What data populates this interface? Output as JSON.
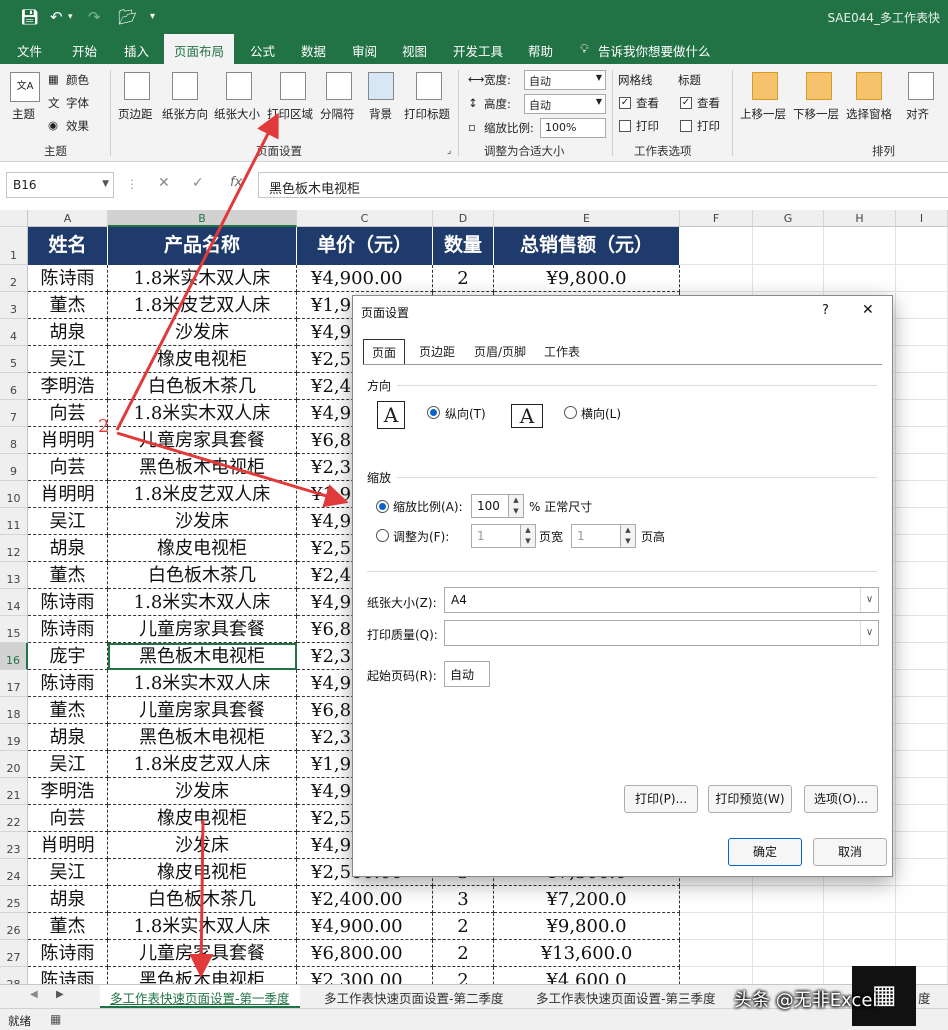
{
  "title_bar": {
    "doc_title": "SAE044_多工作表快"
  },
  "menu": {
    "tabs": [
      "文件",
      "开始",
      "插入",
      "页面布局",
      "公式",
      "数据",
      "审阅",
      "视图",
      "开发工具",
      "帮助"
    ],
    "tell_me": "告诉我你想要做什么"
  },
  "ribbon": {
    "theme": {
      "theme": "主题",
      "colors": "颜色",
      "fonts": "字体",
      "effects": "效果",
      "group": "主题"
    },
    "page_setup": {
      "margins": "页边距",
      "orientation": "纸张方向",
      "size": "纸张大小",
      "print_area": "打印区域",
      "breaks": "分隔符",
      "background": "背景",
      "print_titles": "打印标题",
      "group": "页面设置"
    },
    "scale": {
      "width_label": "宽度:",
      "width_value": "自动",
      "height_label": "高度:",
      "height_value": "自动",
      "scale_label": "缩放比例:",
      "scale_value": "100%",
      "group": "调整为合适大小"
    },
    "sheet_options": {
      "gridlines": "网格线",
      "headings": "标题",
      "view": "查看",
      "print": "打印",
      "group": "工作表选项"
    },
    "arrange": {
      "forward": "上移一层",
      "backward": "下移一层",
      "selection_pane": "选择窗格",
      "align": "对齐",
      "group": "排列"
    }
  },
  "formula_bar": {
    "name_box": "B16",
    "fx": "fx",
    "content": "黑色板木电视柜"
  },
  "columns": [
    "A",
    "B",
    "C",
    "D",
    "E",
    "F",
    "G",
    "H",
    "I"
  ],
  "table": {
    "headers": [
      "姓名",
      "产品名称",
      "单价（元）",
      "数量",
      "总销售额（元）"
    ],
    "rows": [
      [
        "陈诗雨",
        "1.8米实木双人床",
        "¥4,900.00",
        "2",
        "¥9,800.0"
      ],
      [
        "董杰",
        "1.8米皮艺双人床",
        "¥1,9",
        "",
        ""
      ],
      [
        "胡泉",
        "沙发床",
        "¥4,9",
        "",
        ""
      ],
      [
        "吴江",
        "橡皮电视柜",
        "¥2,5",
        "",
        ""
      ],
      [
        "李明浩",
        "白色板木茶几",
        "¥2,4",
        "",
        ""
      ],
      [
        "向芸",
        "1.8米实木双人床",
        "¥4,9",
        "",
        ""
      ],
      [
        "肖明明",
        "儿童房家具套餐",
        "¥6,8",
        "",
        ""
      ],
      [
        "向芸",
        "黑色板木电视柜",
        "¥2,3",
        "",
        ""
      ],
      [
        "肖明明",
        "1.8米皮艺双人床",
        "¥1,9",
        "",
        ""
      ],
      [
        "吴江",
        "沙发床",
        "¥4,9",
        "",
        ""
      ],
      [
        "胡泉",
        "橡皮电视柜",
        "¥2,5",
        "",
        ""
      ],
      [
        "董杰",
        "白色板木茶几",
        "¥2,4",
        "",
        ""
      ],
      [
        "陈诗雨",
        "1.8米实木双人床",
        "¥4,9",
        "",
        ""
      ],
      [
        "陈诗雨",
        "儿童房家具套餐",
        "¥6,8",
        "",
        ""
      ],
      [
        "庞宇",
        "黑色板木电视柜",
        "¥2,3",
        "",
        ""
      ],
      [
        "陈诗雨",
        "1.8米实木双人床",
        "¥4,9",
        "",
        ""
      ],
      [
        "董杰",
        "儿童房家具套餐",
        "¥6,8",
        "",
        ""
      ],
      [
        "胡泉",
        "黑色板木电视柜",
        "¥2,3",
        "",
        ""
      ],
      [
        "吴江",
        "1.8米皮艺双人床",
        "¥1,9",
        "",
        ""
      ],
      [
        "李明浩",
        "沙发床",
        "¥4,9",
        "",
        ""
      ],
      [
        "向芸",
        "橡皮电视柜",
        "¥2,5",
        "",
        ""
      ],
      [
        "肖明明",
        "沙发床",
        "¥4,9",
        "",
        ""
      ],
      [
        "吴江",
        "橡皮电视柜",
        "¥2,500.00",
        "3",
        "¥7,500.0"
      ],
      [
        "胡泉",
        "白色板木茶几",
        "¥2,400.00",
        "3",
        "¥7,200.0"
      ],
      [
        "董杰",
        "1.8米实木双人床",
        "¥4,900.00",
        "2",
        "¥9,800.0"
      ],
      [
        "陈诗雨",
        "儿童房家具套餐",
        "¥6,800.00",
        "2",
        "¥13,600.0"
      ],
      [
        "陈诗雨",
        "黑色板木电视柜",
        "¥2,300.00",
        "2",
        "¥4,600.0"
      ]
    ]
  },
  "sheets": [
    "多工作表快速页面设置-第一季度",
    "多工作表快速页面设置-第二季度",
    "多工作表快速页面设置-第三季度",
    "度"
  ],
  "status": {
    "ready": "就绪"
  },
  "annotation": {
    "two": "2"
  },
  "watermark": "头条 @无非Excel",
  "dialog": {
    "title": "页面设置",
    "help": "?",
    "close": "✕",
    "tabs": [
      "页面",
      "页边距",
      "页眉/页脚",
      "工作表"
    ],
    "orientation_label": "方向",
    "portrait": "纵向(T)",
    "landscape": "横向(L)",
    "scale_label": "缩放",
    "adjust_to": "缩放比例(A):",
    "adjust_value": "100",
    "normal_size": "% 正常尺寸",
    "fit_to": "调整为(F):",
    "fit_wide_value": "1",
    "pages_wide": "页宽",
    "fit_tall_value": "1",
    "pages_tall": "页高",
    "paper_size_label": "纸张大小(Z):",
    "paper_size_value": "A4",
    "print_quality_label": "打印质量(Q):",
    "print_quality_value": "",
    "first_page_label": "起始页码(R):",
    "first_page_value": "自动",
    "print_btn": "打印(P)...",
    "preview_btn": "打印预览(W)",
    "options_btn": "选项(O)...",
    "ok_btn": "确定",
    "cancel_btn": "取消"
  }
}
